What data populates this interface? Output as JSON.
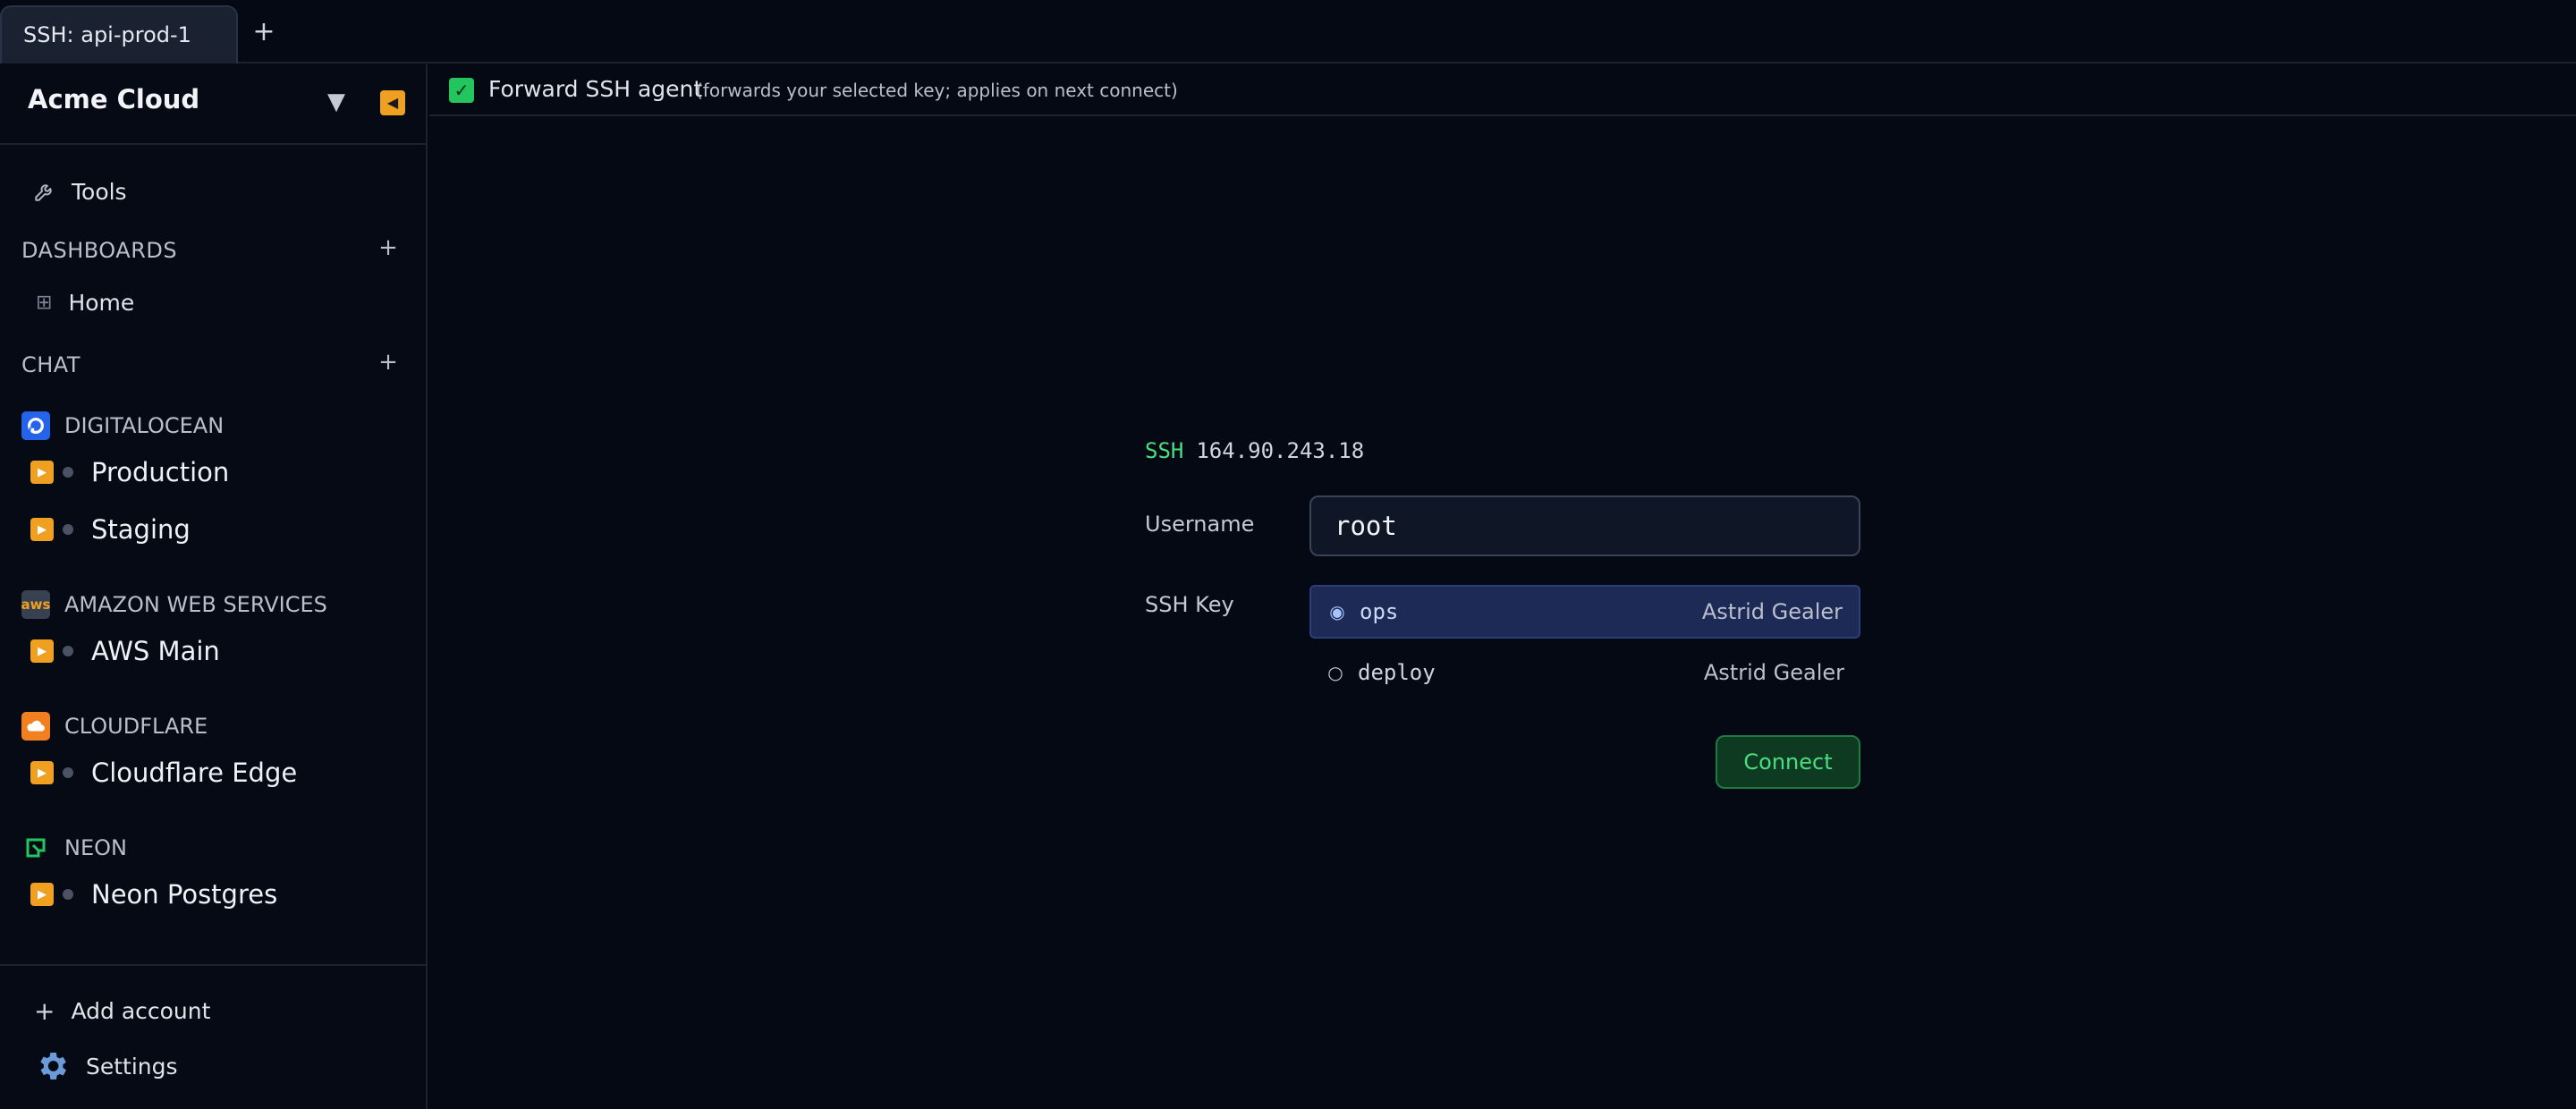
{
  "tabs": [
    {
      "label": "SSH: api-prod-1"
    }
  ],
  "new_tab_label": "+",
  "sidebar": {
    "workspace": "Acme Cloud",
    "tools_label": "Tools",
    "dashboards": {
      "title": "DASHBOARDS",
      "add": "+",
      "items": [
        {
          "label": "Home"
        }
      ]
    },
    "chat": {
      "title": "CHAT",
      "add": "+"
    },
    "providers": [
      {
        "name": "DIGITALOCEAN",
        "icon": "digitalocean-icon",
        "color": "#2563eb",
        "connections": [
          "Production",
          "Staging"
        ]
      },
      {
        "name": "AMAZON WEB SERVICES",
        "icon": "aws-icon",
        "color": "#374151",
        "connections": [
          "AWS Main"
        ]
      },
      {
        "name": "CLOUDFLARE",
        "icon": "cloudflare-icon",
        "color": "#f38020",
        "connections": [
          "Cloudflare Edge"
        ]
      },
      {
        "name": "NEON",
        "icon": "neon-icon",
        "color": "#22c55e",
        "connections": [
          "Neon Postgres"
        ]
      }
    ],
    "add_account": "Add account",
    "settings": "Settings"
  },
  "options": {
    "forward_agent_label": "Forward SSH agent",
    "forward_agent_hint": "(forwards your selected key; applies on next connect)",
    "forward_agent_checked": true
  },
  "ssh": {
    "protocol": "SSH",
    "host": "164.90.243.18",
    "username_label": "Username",
    "username_value": "root",
    "key_label": "SSH Key",
    "keys": [
      {
        "name": "ops",
        "owner": "Astrid Gealer",
        "selected": true
      },
      {
        "name": "deploy",
        "owner": "Astrid Gealer",
        "selected": false
      }
    ],
    "connect_label": "Connect"
  },
  "colors": {
    "accent_green": "#4ade80",
    "play_orange": "#f0a020",
    "selected_key_bg": "#1c2a55"
  }
}
